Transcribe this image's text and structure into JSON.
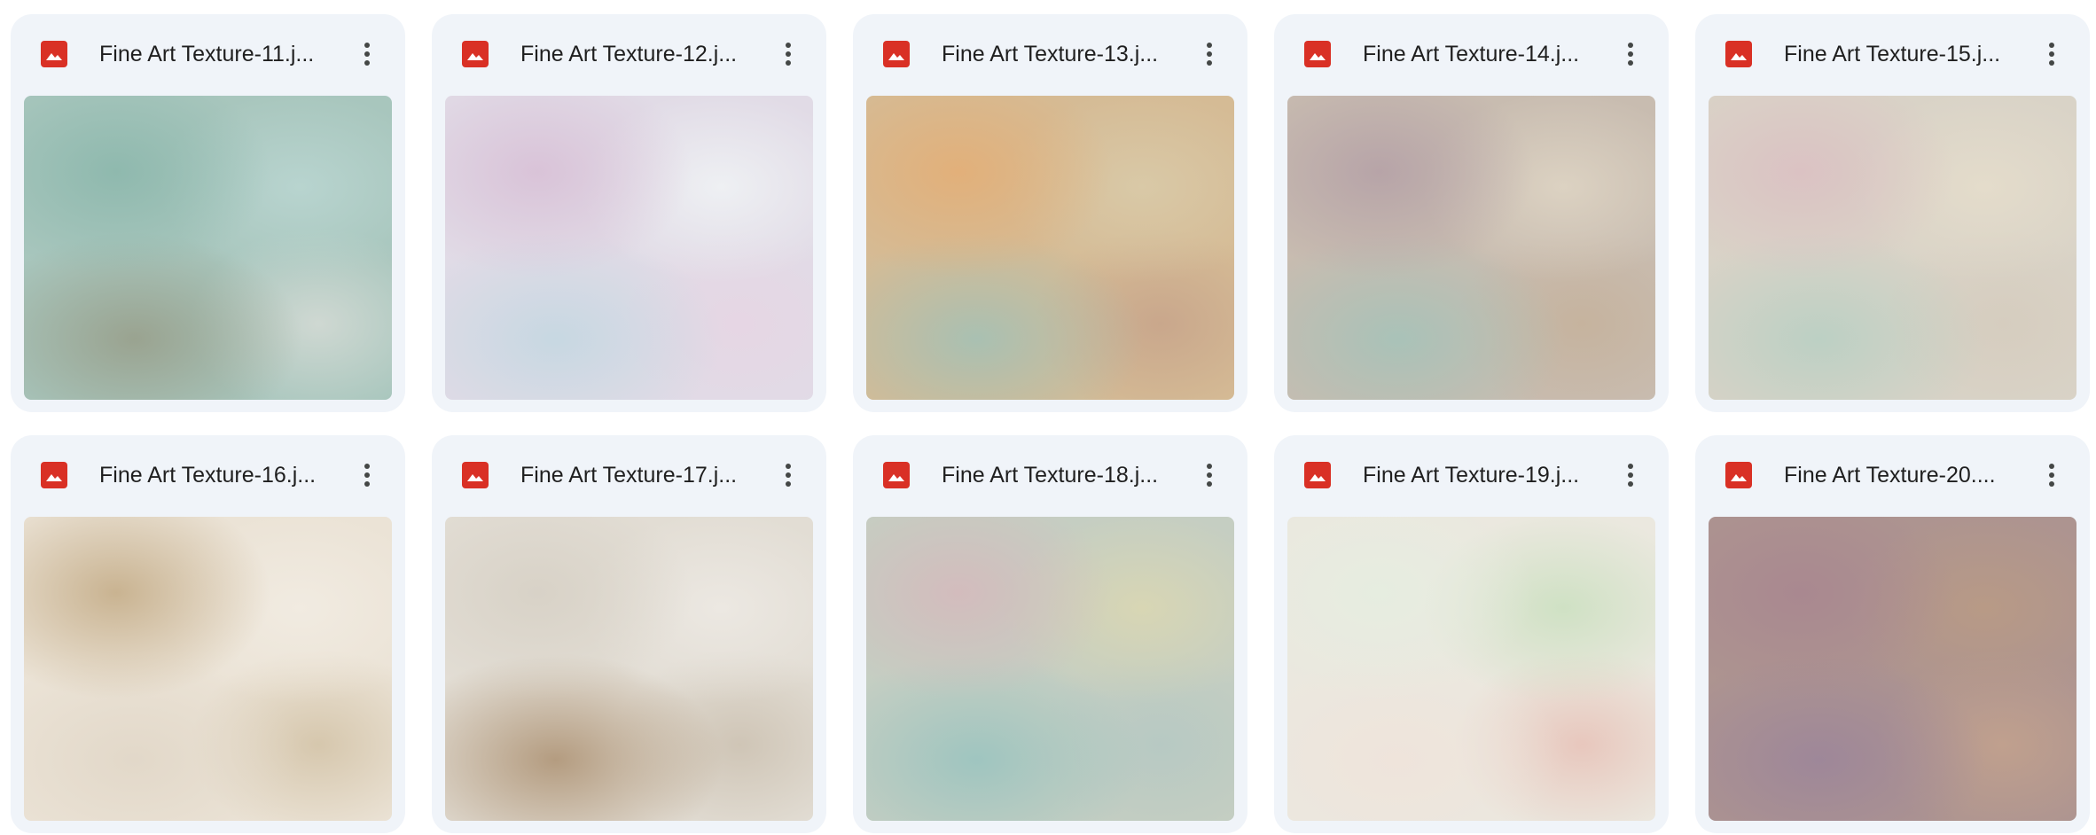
{
  "files": [
    {
      "title": "Fine Art Texture-11.j...",
      "colors": {
        "a": "#8fb9ae",
        "b": "#b8d4cf",
        "c": "#9aa390",
        "d": "#cfd8d2",
        "base": "#a8c6bd"
      }
    },
    {
      "title": "Fine Art Texture-12.j...",
      "colors": {
        "a": "#d9c3d8",
        "b": "#eef0f3",
        "c": "#c7d8e2",
        "d": "#e6d6e4",
        "base": "#e1dbe6"
      }
    },
    {
      "title": "Fine Art Texture-13.j...",
      "colors": {
        "a": "#e2b07a",
        "b": "#d9c9a7",
        "c": "#a9c0b2",
        "d": "#c9a78c",
        "base": "#d5bb95"
      }
    },
    {
      "title": "Fine Art Texture-14.j...",
      "colors": {
        "a": "#b7a4a8",
        "b": "#dcd2c2",
        "c": "#a9c2b8",
        "d": "#c6b39e",
        "base": "#c8bcb0"
      }
    },
    {
      "title": "Fine Art Texture-15.j...",
      "colors": {
        "a": "#dbc2c3",
        "b": "#e4dccb",
        "c": "#bcd0c4",
        "d": "#d6cdbf",
        "base": "#d9d3c7"
      }
    },
    {
      "title": "Fine Art Texture-16.j...",
      "colors": {
        "a": "#c9b391",
        "b": "#f1ebe1",
        "c": "#e2d8c9",
        "d": "#d6c7ad",
        "base": "#ebe3d6"
      }
    },
    {
      "title": "Fine Art Texture-17.j...",
      "colors": {
        "a": "#d8d2c7",
        "b": "#ece8e2",
        "c": "#b49c80",
        "d": "#cfc5b6",
        "base": "#e2ddd4"
      }
    },
    {
      "title": "Fine Art Texture-18.j...",
      "colors": {
        "a": "#d3bcbd",
        "b": "#d8d6b4",
        "c": "#9fc5c0",
        "d": "#b7c9c3",
        "base": "#c5cec2"
      }
    },
    {
      "title": "Fine Art Texture-19.j...",
      "colors": {
        "a": "#e6ede0",
        "b": "#cfe1c4",
        "c": "#efe4db",
        "d": "#e8c7bd",
        "base": "#ebe8df"
      }
    },
    {
      "title": "Fine Art Texture-20....",
      "colors": {
        "a": "#a98890",
        "b": "#b89a86",
        "c": "#9e8799",
        "d": "#c0a08e",
        "base": "#ad9490"
      }
    }
  ],
  "icons": {
    "file_type": "image-icon",
    "more": "more-vert-icon"
  },
  "accent_colors": {
    "card_bg": "#f0f4f9",
    "image_icon": "#d93025",
    "title_text": "#1f1f1f"
  }
}
